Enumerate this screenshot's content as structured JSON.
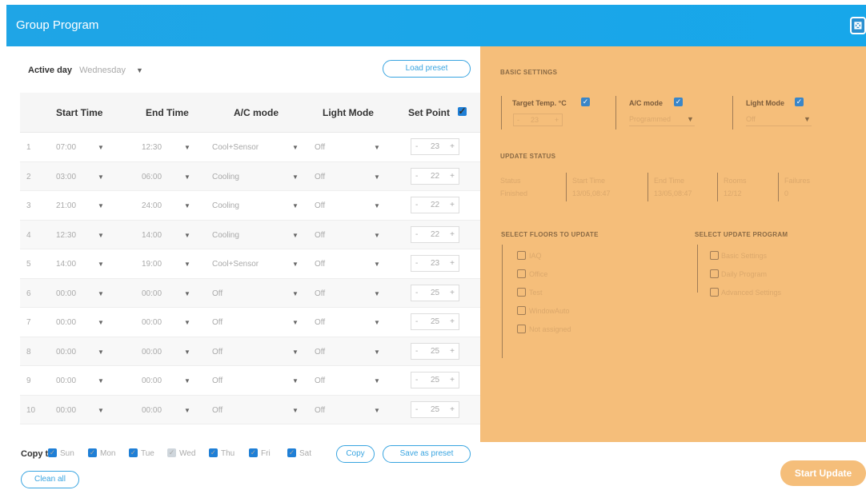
{
  "window": {
    "title": "Group Program",
    "close_label": "⊠"
  },
  "active_day": {
    "label": "Active day",
    "value": "Wednesday"
  },
  "load_preset": "Load preset",
  "columns": [
    "Start Time",
    "End Time",
    "A/C mode",
    "Light Mode",
    "Set Point"
  ],
  "rows": [
    {
      "n": "1",
      "start": "07:00",
      "end": "12:30",
      "ac": "Cool+Sensor",
      "light": "Off",
      "sp": "23"
    },
    {
      "n": "2",
      "start": "03:00",
      "end": "06:00",
      "ac": "Cooling",
      "light": "Off",
      "sp": "22"
    },
    {
      "n": "3",
      "start": "21:00",
      "end": "24:00",
      "ac": "Cooling",
      "light": "Off",
      "sp": "22"
    },
    {
      "n": "4",
      "start": "12:30",
      "end": "14:00",
      "ac": "Cooling",
      "light": "Off",
      "sp": "22"
    },
    {
      "n": "5",
      "start": "14:00",
      "end": "19:00",
      "ac": "Cool+Sensor",
      "light": "Off",
      "sp": "23"
    },
    {
      "n": "6",
      "start": "00:00",
      "end": "00:00",
      "ac": "Off",
      "light": "Off",
      "sp": "25"
    },
    {
      "n": "7",
      "start": "00:00",
      "end": "00:00",
      "ac": "Off",
      "light": "Off",
      "sp": "25"
    },
    {
      "n": "8",
      "start": "00:00",
      "end": "00:00",
      "ac": "Off",
      "light": "Off",
      "sp": "25"
    },
    {
      "n": "9",
      "start": "00:00",
      "end": "00:00",
      "ac": "Off",
      "light": "Off",
      "sp": "25"
    },
    {
      "n": "10",
      "start": "00:00",
      "end": "00:00",
      "ac": "Off",
      "light": "Off",
      "sp": "25"
    }
  ],
  "copy": {
    "label": "Copy to",
    "days": [
      {
        "name": "Sun",
        "checked": true
      },
      {
        "name": "Mon",
        "checked": true
      },
      {
        "name": "Tue",
        "checked": true
      },
      {
        "name": "Wed",
        "checked": false
      },
      {
        "name": "Thu",
        "checked": true
      },
      {
        "name": "Fri",
        "checked": true
      },
      {
        "name": "Sat",
        "checked": true
      }
    ],
    "copy_btn": "Copy",
    "save_preset": "Save as preset"
  },
  "clear_all": "Clean all",
  "basic": {
    "heading": "BASIC SETTINGS",
    "target_label": "Target Temp. °C",
    "target_value": "23",
    "ac_label": "A/C mode",
    "ac_value": "Programmed",
    "light_label": "Light Mode",
    "light_value": "Off"
  },
  "status": {
    "heading": "UPDATE STATUS",
    "cols": [
      {
        "k": "Status",
        "v": "Finished"
      },
      {
        "k": "Start Time",
        "v": "13/05,08:47"
      },
      {
        "k": "End Time",
        "v": "13/05,08:47"
      },
      {
        "k": "Rooms",
        "v": "12/12"
      },
      {
        "k": "Failures",
        "v": "0"
      }
    ]
  },
  "floors": {
    "heading": "SELECT FLOORS TO UPDATE",
    "items": [
      "IAQ",
      "Office",
      "Test",
      "WindowAuto",
      "Not assigned"
    ]
  },
  "program": {
    "heading": "SELECT UPDATE PROGRAM",
    "items": [
      "Basic Settings",
      "Daily Program",
      "Advanced Settings"
    ]
  },
  "start_update": "Start Update"
}
